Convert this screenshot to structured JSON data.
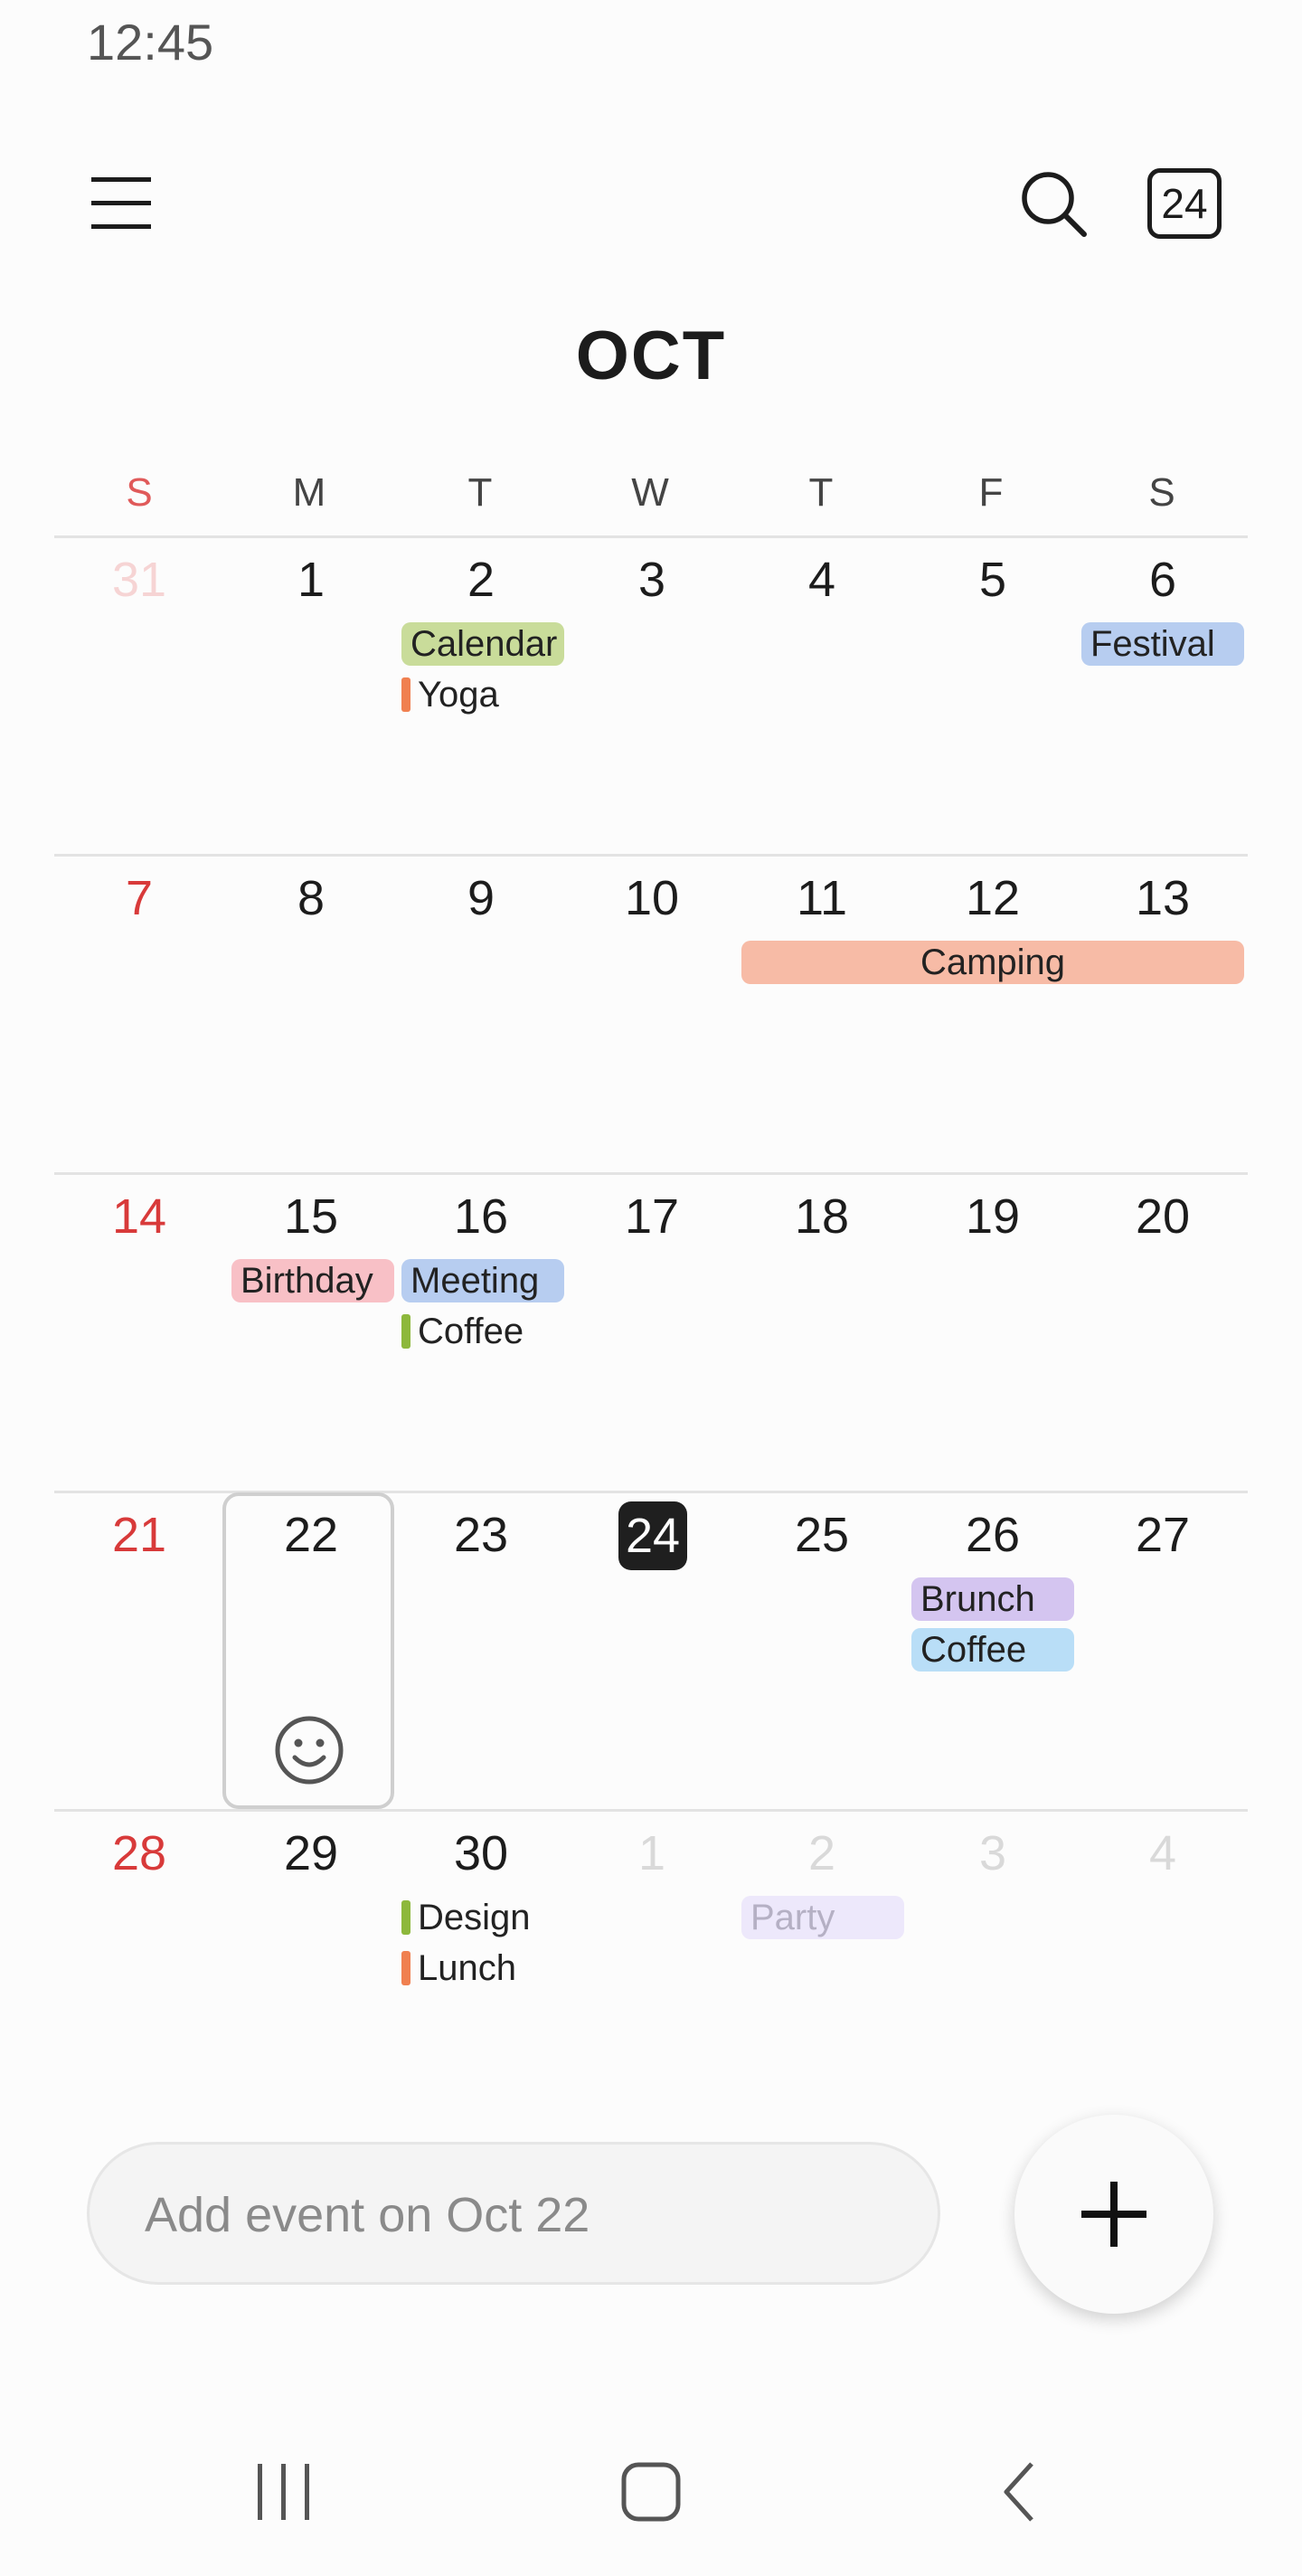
{
  "status": {
    "time": "12:45"
  },
  "toolbar": {
    "today_label": "24"
  },
  "month": "OCT",
  "weekdays": [
    "S",
    "M",
    "T",
    "W",
    "T",
    "F",
    "S"
  ],
  "weeks": [
    [
      "31",
      "1",
      "2",
      "3",
      "4",
      "5",
      "6"
    ],
    [
      "7",
      "8",
      "9",
      "10",
      "11",
      "12",
      "13"
    ],
    [
      "14",
      "15",
      "16",
      "17",
      "18",
      "19",
      "20"
    ],
    [
      "21",
      "22",
      "23",
      "24",
      "25",
      "26",
      "27"
    ],
    [
      "28",
      "29",
      "30",
      "1",
      "2",
      "3",
      "4"
    ]
  ],
  "events": {
    "calendar": "Calendar",
    "yoga": "Yoga",
    "festival": "Festival",
    "camping": "Camping",
    "birthday": "Birthday",
    "meeting": "Meeting",
    "coffee1": "Coffee",
    "brunch": "Brunch",
    "coffee2": "Coffee",
    "design": "Design",
    "lunch": "Lunch",
    "party": "Party"
  },
  "add_event": {
    "placeholder": "Add event on Oct 22"
  },
  "colors": {
    "calendar": "#c9dc9a",
    "festival": "#b7cdf0",
    "camping": "#f7bba6",
    "birthday": "#f8c0c6",
    "meeting": "#b7cdf0",
    "brunch": "#d4c5f0",
    "coffee2": "#b9def7",
    "party": "#ede8fb",
    "orange_mark": "#f08050",
    "green_mark": "#8db83c"
  }
}
